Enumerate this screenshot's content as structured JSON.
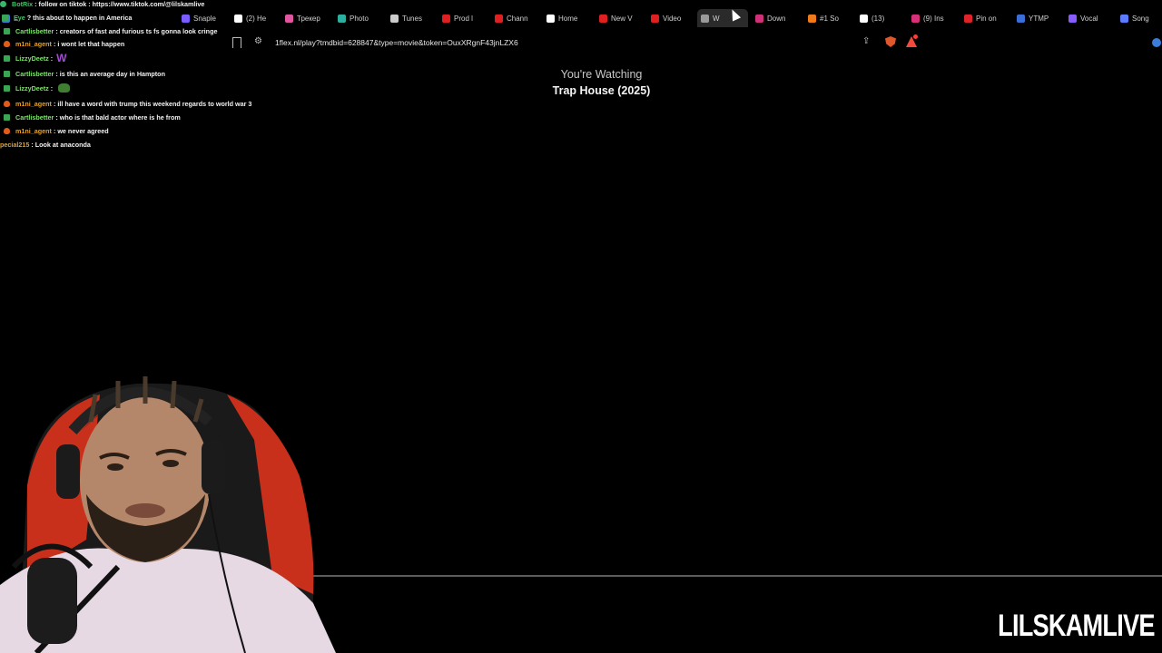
{
  "browser": {
    "tabs": [
      {
        "label": "E",
        "favicon_color": "#3b7dd8",
        "icon": "edge-icon"
      },
      {
        "label": "Snaple",
        "favicon_color": "#7b5cff",
        "icon": "snaple-icon"
      },
      {
        "label": "(2) He",
        "favicon_color": "#ffffff",
        "icon": "x-icon"
      },
      {
        "label": "Трекер",
        "favicon_color": "#e056a0",
        "icon": "tracker-icon"
      },
      {
        "label": "Photo",
        "favicon_color": "#2bb0a0",
        "icon": "photo-icon"
      },
      {
        "label": "Tunes",
        "favicon_color": "#cccccc",
        "icon": "tunes-icon"
      },
      {
        "label": "Prod l",
        "favicon_color": "#e02020",
        "icon": "youtube-icon"
      },
      {
        "label": "Chann",
        "favicon_color": "#e02020",
        "icon": "youtube-icon"
      },
      {
        "label": "Home",
        "favicon_color": "#ffffff",
        "icon": "x-icon"
      },
      {
        "label": "New V",
        "favicon_color": "#e02020",
        "icon": "youtube-icon"
      },
      {
        "label": "Video",
        "favicon_color": "#e02020",
        "icon": "youtube-icon"
      },
      {
        "label": "W",
        "favicon_color": "#9a9a9a",
        "icon": "cloud-icon",
        "active": true
      },
      {
        "label": "Down",
        "favicon_color": "#d0307a",
        "icon": "download-icon"
      },
      {
        "label": "#1 So",
        "favicon_color": "#f07a1a",
        "icon": "sound-icon"
      },
      {
        "label": "(13)",
        "favicon_color": "#ffffff",
        "icon": "tiktok-icon"
      },
      {
        "label": "(9) Ins",
        "favicon_color": "#d6307a",
        "icon": "instagram-icon"
      },
      {
        "label": "Pin on",
        "favicon_color": "#e0232a",
        "icon": "pinterest-icon"
      },
      {
        "label": "YTMP",
        "favicon_color": "#3b6fd8",
        "icon": "ytmp-icon"
      },
      {
        "label": "Vocal",
        "favicon_color": "#8a5cff",
        "icon": "vocal-icon"
      },
      {
        "label": "Song",
        "favicon_color": "#5c7cff",
        "icon": "song-icon"
      }
    ],
    "url": "1flex.nl/play?tmdbid=628847&type=movie&token=OuxXRgnF43jnLZX6"
  },
  "chat": {
    "messages": [
      {
        "user": "BotRix",
        "text": ": follow on tiktok : https://www.tiktok.com/@lilskamlive",
        "user_color": "#3fc36a",
        "badge": "bot"
      },
      {
        "user": "Eye",
        "text": "? this about to happen in America",
        "user_color": "#3fc36a",
        "badge": "mod"
      },
      {
        "user": "Cartlisbetter",
        "text": ": creators of fast and furious ts fs gonna look cringe",
        "user_color": "#7ce36a",
        "badge": "mod"
      },
      {
        "user": "m1ni_agent",
        "text": ": i wont let that happen",
        "user_color": "#e8a020",
        "badge": "fire"
      },
      {
        "user": "LizzyDeetz",
        "text": ":",
        "user_color": "#7ce36a",
        "badge": "mod",
        "emote": "W"
      },
      {
        "user": "Cartlisbetter",
        "text": ": is this an average day in Hampton",
        "user_color": "#7ce36a",
        "badge": "mod"
      },
      {
        "user": "LizzyDeetz",
        "text": ":",
        "user_color": "#7ce36a",
        "badge": "mod",
        "emote": "frog"
      },
      {
        "user": "m1ni_agent",
        "text": ": ill have a word with trump this weekend regards to world war 3",
        "user_color": "#e8a020",
        "badge": "fire"
      },
      {
        "user": "Cartlisbetter",
        "text": ": who is that bald actor where is he from",
        "user_color": "#7ce36a",
        "badge": "mod"
      },
      {
        "user": "m1ni_agent",
        "text": ": we never agreed",
        "user_color": "#e8a020",
        "badge": "fire"
      },
      {
        "user": "pecial215",
        "text": ": Look at anaconda",
        "user_color": "#e8a020",
        "badge": "none"
      }
    ]
  },
  "player": {
    "watching_label": "You're Watching",
    "title": "Trap House (2025)"
  },
  "watermark": "LILSKAMLIVE"
}
